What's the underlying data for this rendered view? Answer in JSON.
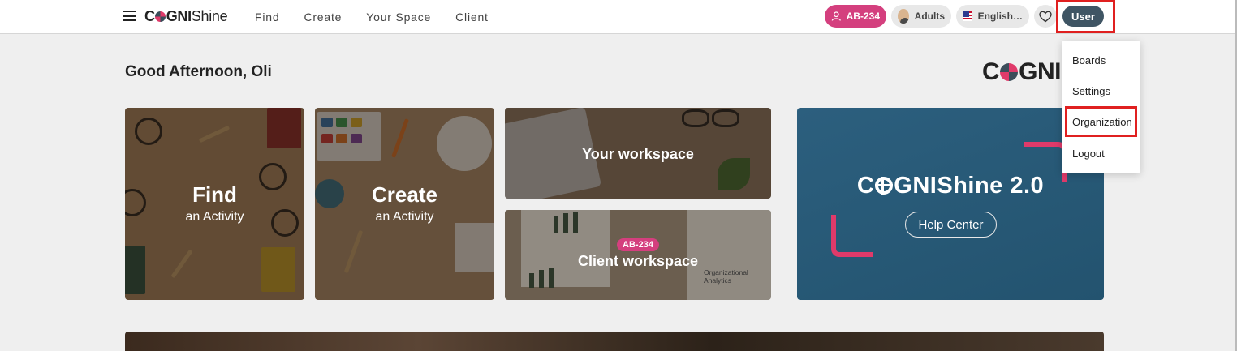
{
  "header": {
    "logo_bold": "C",
    "logo_mid": "GNI",
    "logo_light": "Shine",
    "nav": [
      {
        "label": "Find"
      },
      {
        "label": "Create"
      },
      {
        "label": "Your Space"
      },
      {
        "label": "Client"
      }
    ],
    "client_badge": "AB-234",
    "audience": "Adults",
    "language": "English…",
    "user_label": "User"
  },
  "main": {
    "greeting": "Good Afternoon, Oli",
    "brand_logo": "C",
    "brand_logo_rest": "GNIS",
    "cards": {
      "find": {
        "title": "Find",
        "subtitle": "an Activity"
      },
      "create": {
        "title": "Create",
        "subtitle": "an Activity"
      },
      "workspace": {
        "title": "Your workspace"
      },
      "client": {
        "tag": "AB-234",
        "title": "Client workspace",
        "caption": "Organizational Analytics"
      }
    },
    "promo": {
      "title_c": "C",
      "title_rest": "GNIShine 2.0",
      "button": "Help Center"
    }
  },
  "user_menu": {
    "items": [
      {
        "label": "Boards"
      },
      {
        "label": "Settings"
      },
      {
        "label": "Organization"
      },
      {
        "label": "Logout"
      }
    ]
  },
  "colors": {
    "accent_pink": "#d43f7e",
    "user_button": "#3f5564",
    "promo_bg": "#2c5f7e",
    "highlight": "#e02020"
  },
  "icons": [
    "hamburger-icon",
    "person-icon",
    "avatar-icon",
    "us-flag-icon",
    "heart-icon"
  ]
}
